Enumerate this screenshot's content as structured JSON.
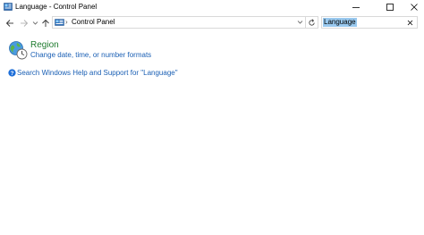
{
  "window": {
    "title": "Language - Control Panel",
    "icon": "control-panel-icon"
  },
  "caption_buttons": [
    "minimize-icon",
    "maximize-icon",
    "close-icon"
  ],
  "navigation": {
    "back_icon": "arrow-left-icon",
    "forward_icon": "arrow-right-icon",
    "recent_icon": "chevron-down-icon",
    "up_icon": "arrow-up-icon"
  },
  "address": {
    "separator": "›",
    "path": "Control Panel",
    "dropdown_icon": "chevron-down-icon",
    "refresh_icon": "refresh-icon"
  },
  "search": {
    "value": "Language",
    "clear_icon": "close-icon"
  },
  "results": [
    {
      "title": "Region",
      "task": "Change date, time, or number formats",
      "icon": "globe-clock-icon"
    }
  ],
  "help": {
    "text": "Search Windows Help and Support for \"Language\"",
    "icon": "help-icon"
  },
  "colors": {
    "title_link": "#1e7b2e",
    "task_link": "#1a5fb4",
    "selection": "#99c9ef",
    "border": "#d9d9d9"
  }
}
